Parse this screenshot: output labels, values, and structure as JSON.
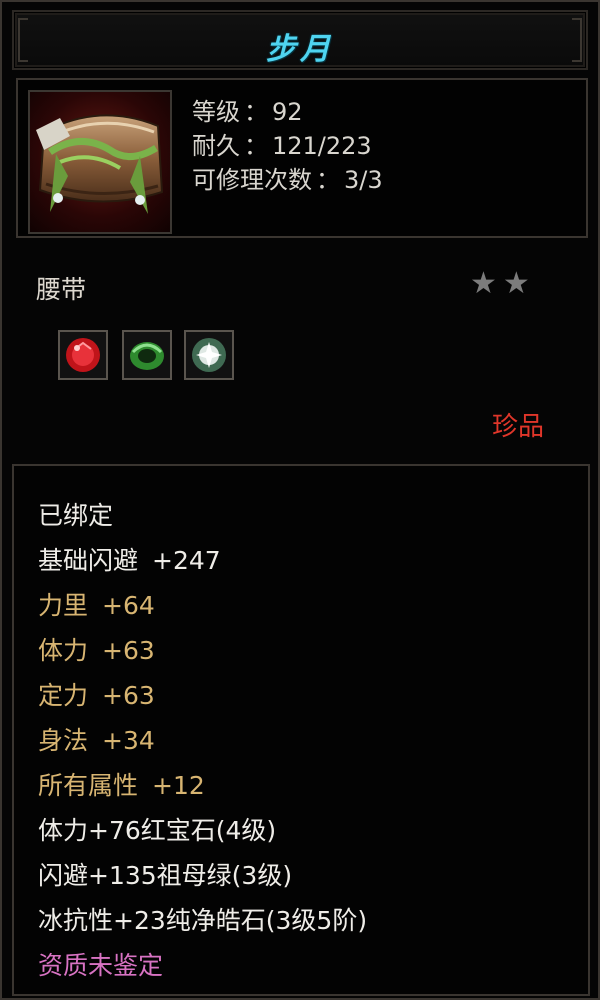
{
  "tooltip": {
    "title": "步月",
    "stats": [
      {
        "label": "等级",
        "value": "92"
      },
      {
        "label": "耐久",
        "value": "121/223"
      },
      {
        "label": "可修理次数",
        "value": "3/3"
      }
    ],
    "separator": "：",
    "item_type": "腰带",
    "stars_text": "★★",
    "star_count": 2,
    "gems": [
      "ruby-gem-icon",
      "emerald-gem-icon",
      "diamond-gem-icon"
    ],
    "rarity": "珍品",
    "bound_status": "已绑定",
    "base_attr": {
      "label": "基础闪避",
      "value": "+247"
    },
    "gold_attrs": [
      {
        "label": "力里",
        "value": "+64"
      },
      {
        "label": "体力",
        "value": "+63"
      },
      {
        "label": "定力",
        "value": "+63"
      },
      {
        "label": "身法",
        "value": "+34"
      },
      {
        "label": "所有属性",
        "value": "+12"
      }
    ],
    "gem_attrs": [
      "体力+76红宝石(4级)",
      "闪避+135祖母绿(3级)",
      "冰抗性+23纯净皓石(3级5阶)"
    ],
    "quality_status": "资质未鉴定"
  },
  "colors": {
    "title": "#4fd4f0",
    "gold_attr": "#d8b572",
    "rarity": "#e0362a",
    "quality": "#d873c3"
  }
}
